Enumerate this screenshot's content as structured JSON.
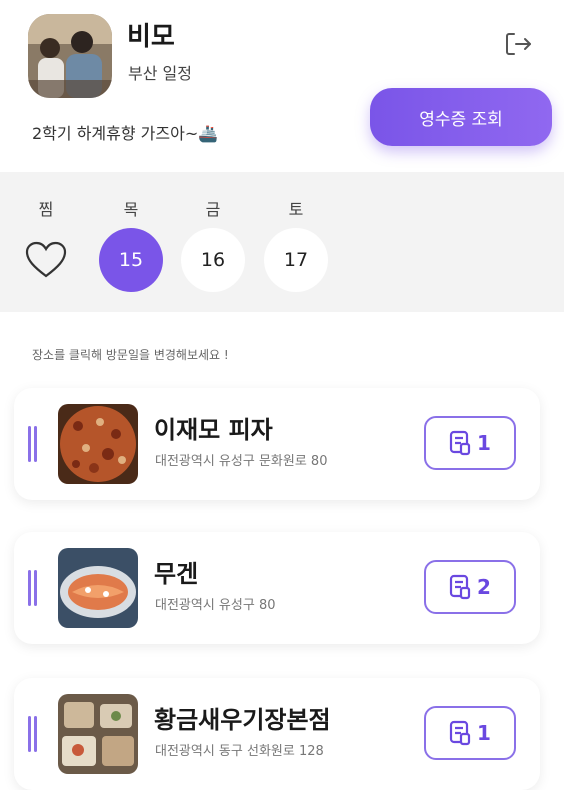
{
  "header": {
    "group_name": "비모",
    "trip_title": "부산 일정",
    "memo": "2학기 하계휴향 가즈아~🚢",
    "receipt_button": "영수증 조회"
  },
  "days": {
    "favorites_label": "찜",
    "items": [
      {
        "weekday": "목",
        "date": "15",
        "selected": true
      },
      {
        "weekday": "금",
        "date": "16",
        "selected": false
      },
      {
        "weekday": "토",
        "date": "17",
        "selected": false
      }
    ]
  },
  "hint": "장소를 클릭해 방문일을 변경해보세요 !",
  "places": [
    {
      "name": "이재모 피자",
      "address": "대전광역시 유성구 문화원로 80",
      "receipt_count": "1"
    },
    {
      "name": "무겐",
      "address": "대전광역시 유성구 80",
      "receipt_count": "2"
    },
    {
      "name": "황금새우기장본점",
      "address": "대전광역시 동구 선화원로 128",
      "receipt_count": "1"
    }
  ],
  "colors": {
    "accent": "#7a55e8",
    "day_bar_bg": "#f3f3f3"
  },
  "icons": {
    "logout": "logout-icon",
    "favorites": "heart-icon",
    "receipt": "receipt-icon",
    "drag": "drag-handle-icon"
  }
}
